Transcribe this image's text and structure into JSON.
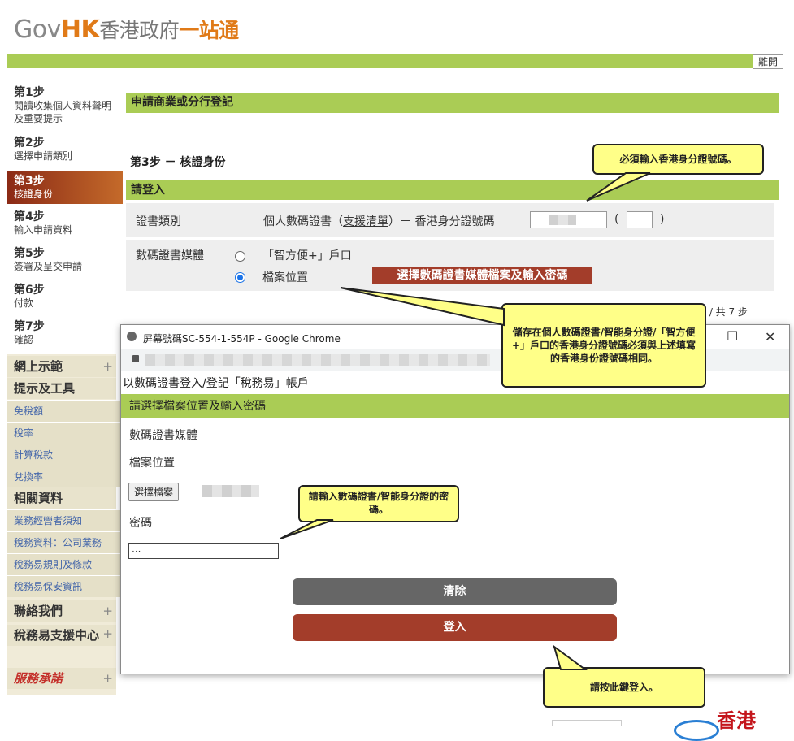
{
  "header": {
    "logo_gov": "Gov",
    "logo_hk": "HK",
    "logo_zh": "香港政府",
    "logo_one": "一站通",
    "logout_label": "離開"
  },
  "steps": [
    {
      "num": "第1步",
      "desc": "閱讀收集個人資料聲明及重要提示"
    },
    {
      "num": "第2步",
      "desc": "選擇申請類別"
    },
    {
      "num": "第3步",
      "desc": "核證身份"
    },
    {
      "num": "第4步",
      "desc": "輸入申請資料"
    },
    {
      "num": "第5步",
      "desc": "簽署及呈交申請"
    },
    {
      "num": "第6步",
      "desc": "付款"
    },
    {
      "num": "第7步",
      "desc": "確認"
    }
  ],
  "nav": {
    "online_demo": "網上示範",
    "tips_tools": "提示及工具",
    "tips_links": [
      "免稅額",
      "稅率",
      "計算稅款",
      "兌換率"
    ],
    "related": "相關資料",
    "related_links": [
      "業務經營者須知",
      "稅務資料：公司業務",
      "稅務易規則及條款",
      "稅務易保安資訊"
    ],
    "contact": "聯絡我們",
    "support": "稅務易支援中心",
    "pledge": "服務承諾",
    "plus": "+"
  },
  "main": {
    "title": "申請商業或分行登記",
    "step_heading": "第3步 － 核證身份",
    "login_band": "請登入",
    "cert_type_label": "證書類別",
    "cert_type_value": "個人數碼證書（",
    "support_list_link": "支援清單",
    "cert_type_suffix": "）－ 香港身分證號碼",
    "paren_open": "(",
    "paren_close": ")",
    "media_label": "數碼證書媒體",
    "option_ismart": "「智方便+」戶口",
    "option_file": "檔案位置",
    "select_button": "選擇數碼證書媒體檔案及輸入密碼",
    "page_of": "步 / 共 7 步"
  },
  "popup": {
    "window_title": "屏幕號碼SC-554-1-554P - Google Chrome",
    "heading": "以數碼證書登入/登記「稅務易」帳戶",
    "band": "請選擇檔案位置及輸入密碼",
    "media_label": "數碼證書媒體",
    "file_label": "檔案位置",
    "choose_file": "選擇檔案",
    "password_label": "密碼",
    "password_value": "···",
    "clear_button": "清除",
    "login_button": "登入",
    "minimize": "—",
    "maximize": "☐",
    "close": "✕"
  },
  "callouts": {
    "hkid_required": "必須輸入香港身分證號碼。",
    "hkid_match": "儲存在個人數碼證書/智能身分證/「智方便+」戶口的香港身分證號碼必須與上述填寫的香港身份證號碼相同。",
    "enter_password": "請輸入數碼證書/智能身分證的密碼。",
    "press_login": "請按此鍵登入。"
  },
  "footer": {
    "seal_text": "香港"
  },
  "colors": {
    "green_band": "#aacc55",
    "brand_orange": "#e07a18",
    "action_red": "#a33d2a",
    "callout_yellow": "#ffff88"
  }
}
